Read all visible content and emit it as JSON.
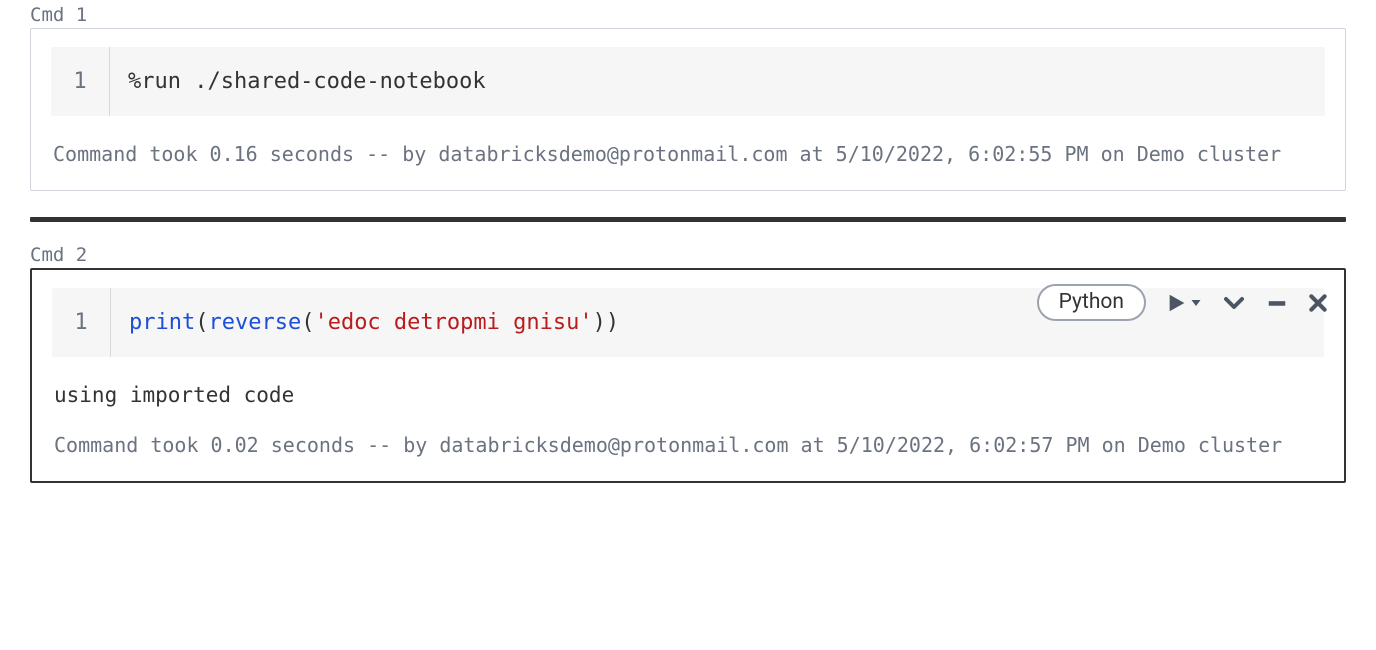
{
  "cells": [
    {
      "label": "Cmd 1",
      "lineNumber": "1",
      "code": {
        "plain": "%run ./shared-code-notebook"
      },
      "status": "Command took 0.16 seconds -- by databricksdemo@protonmail.com at 5/10/2022, 6:02:55 PM on Demo cluster"
    },
    {
      "label": "Cmd 2",
      "lineNumber": "1",
      "lang": "Python",
      "code": {
        "fn1": "print",
        "paren1": "(",
        "fn2": "reverse",
        "paren2": "(",
        "str": "'edoc detropmi gnisu'",
        "close": "))"
      },
      "output": "using imported code",
      "status": "Command took 0.02 seconds -- by databricksdemo@protonmail.com at 5/10/2022, 6:02:57 PM on Demo cluster"
    }
  ]
}
